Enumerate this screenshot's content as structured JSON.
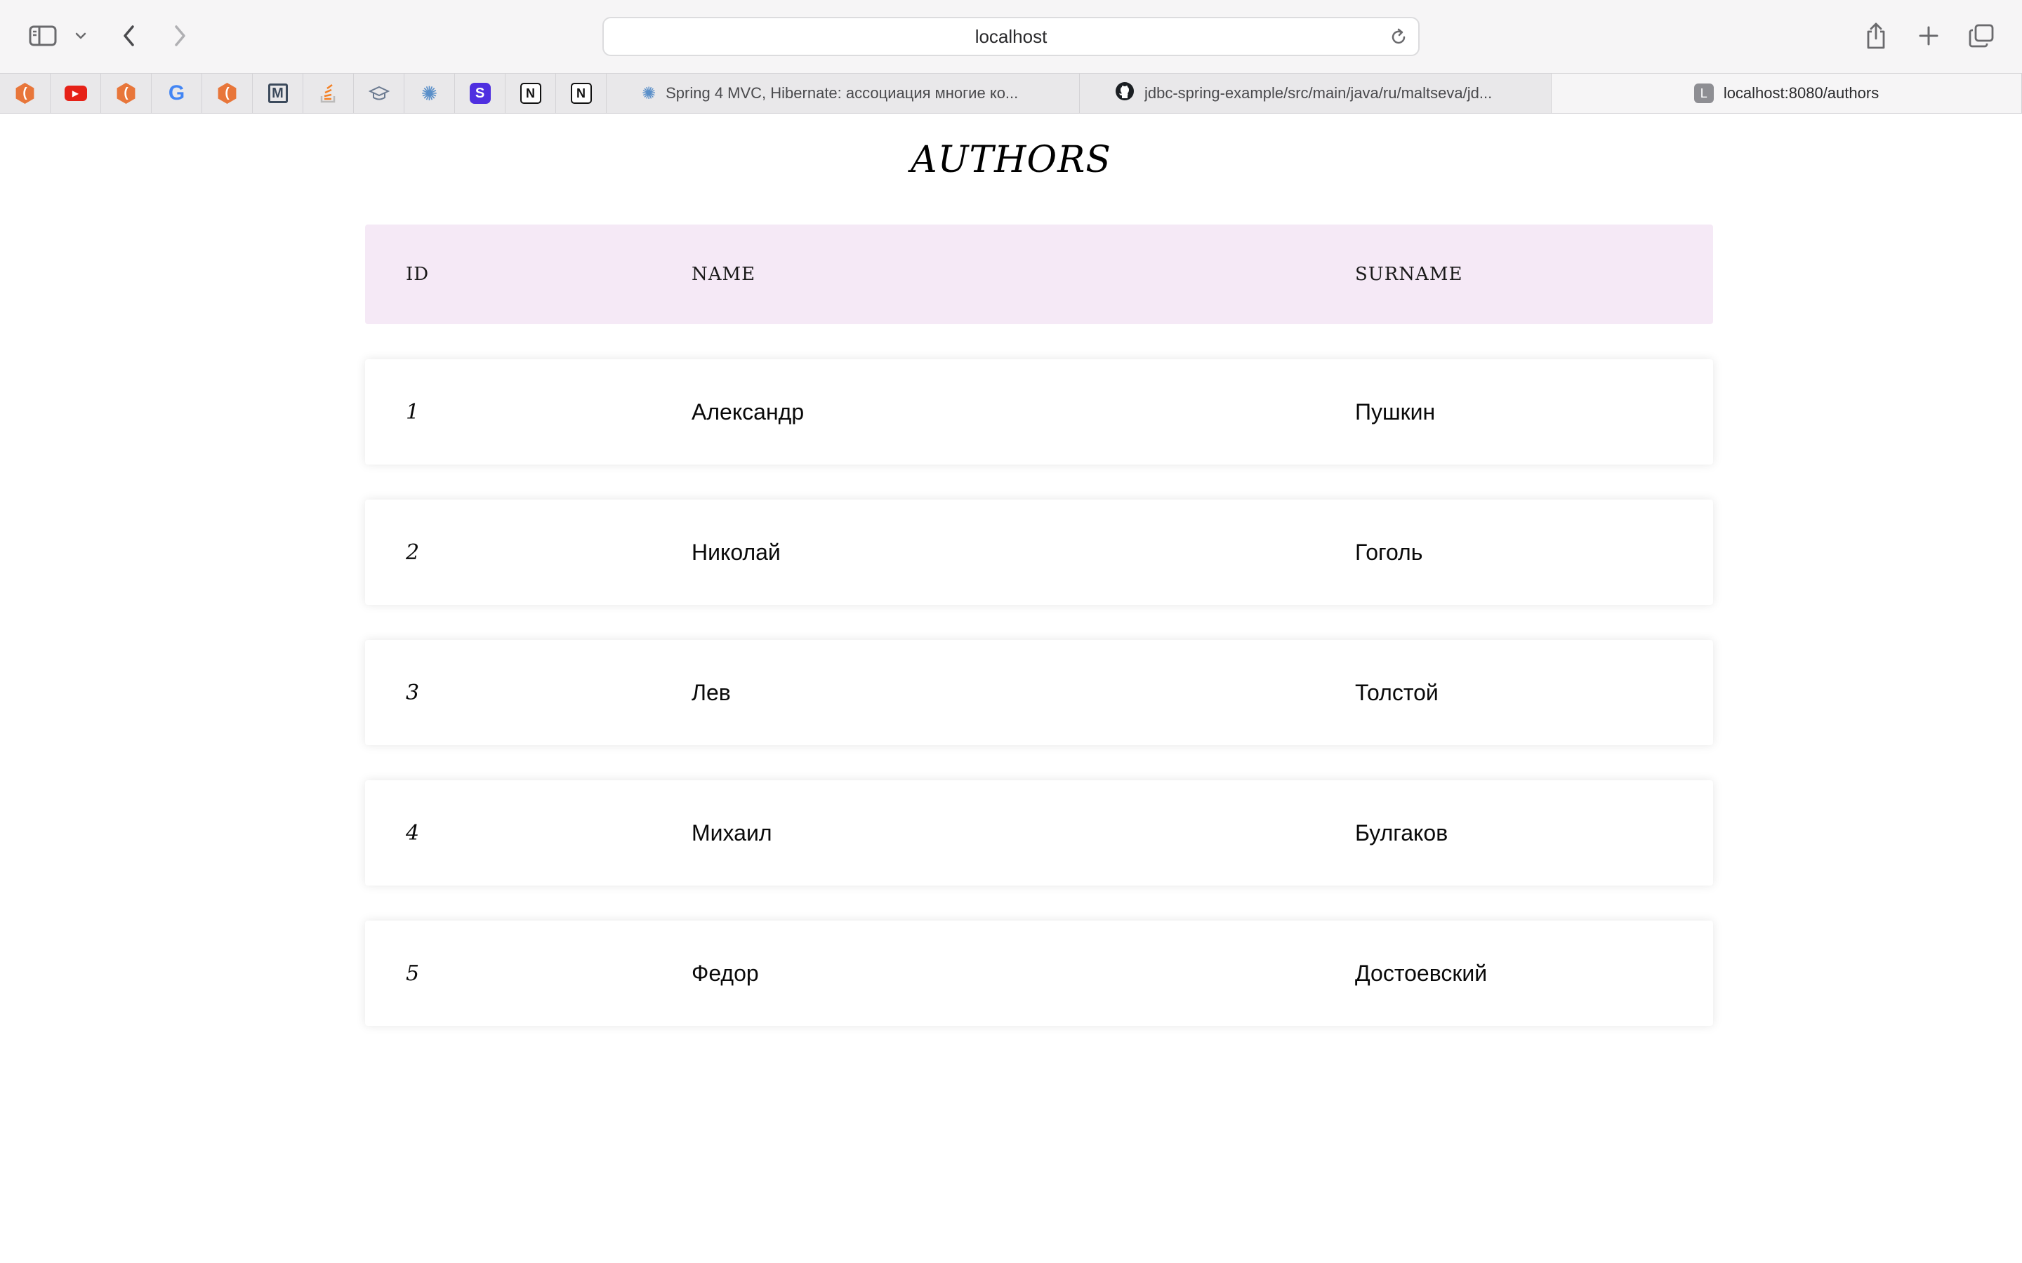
{
  "browser": {
    "url": "localhost",
    "pinned_tabs": [
      {
        "icon": "hexagon-orange-icon",
        "color": "#e8763a"
      },
      {
        "icon": "youtube-icon",
        "color": "#e62117"
      },
      {
        "icon": "hexagon-orange-icon",
        "color": "#e8763a"
      },
      {
        "icon": "google-icon",
        "color": "#4285f4"
      },
      {
        "icon": "hexagon-orange-icon",
        "color": "#e8763a"
      },
      {
        "icon": "gmail-m-icon",
        "color": "#3c4a5c"
      },
      {
        "icon": "stackoverflow-icon",
        "color": "#f48024"
      },
      {
        "icon": "graduation-cap-icon",
        "color": "#6b7a90"
      },
      {
        "icon": "gear-blue-icon",
        "color": "#5a8fc9"
      },
      {
        "icon": "s-square-icon",
        "color": "#4f2fe0"
      },
      {
        "icon": "notion-icon",
        "color": "#111111"
      },
      {
        "icon": "notion-icon",
        "color": "#111111"
      }
    ],
    "tabs": [
      {
        "title": "Spring 4 MVC, Hibernate: ассоциация многие ко...",
        "icon": "gear-blue-icon"
      },
      {
        "title": "jdbc-spring-example/src/main/java/ru/maltseva/jd...",
        "icon": "github-icon"
      },
      {
        "title": "localhost:8080/authors",
        "icon": "letter-l-icon",
        "icon_letter": "L",
        "active": true
      }
    ]
  },
  "page": {
    "title": "AUTHORS",
    "columns": [
      "ID",
      "NAME",
      "SURNAME"
    ],
    "rows": [
      {
        "id": "1",
        "name": "Александр",
        "surname": "Пушкин"
      },
      {
        "id": "2",
        "name": "Николай",
        "surname": "Гоголь"
      },
      {
        "id": "3",
        "name": "Лев",
        "surname": "Толстой"
      },
      {
        "id": "4",
        "name": "Михаил",
        "surname": "Булгаков"
      },
      {
        "id": "5",
        "name": "Федор",
        "surname": "Достоевский"
      }
    ]
  },
  "colors": {
    "header_bg": "#f5e9f6",
    "toolbar_bg": "#f6f5f6",
    "tabbar_bg": "#e9e8ea"
  }
}
